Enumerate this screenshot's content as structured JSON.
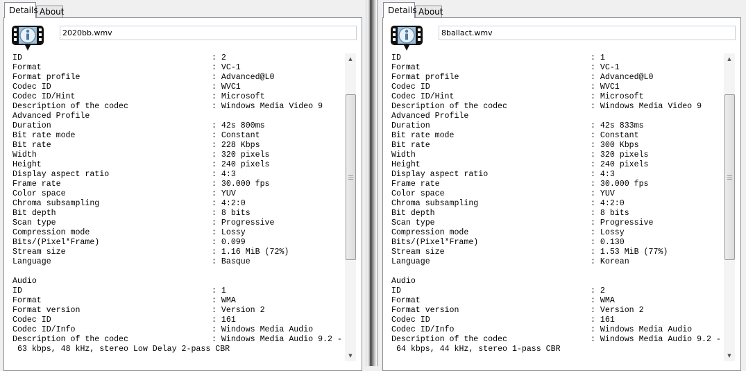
{
  "panels": [
    {
      "tabs": [
        "Details",
        "About"
      ],
      "filename": "2020bb.wmv",
      "scroll_fraction": 0.25,
      "lines": [
        [
          "ID",
          "2"
        ],
        [
          "Format",
          "VC-1"
        ],
        [
          "Format profile",
          "Advanced@L0"
        ],
        [
          "Codec ID",
          "WVC1"
        ],
        [
          "Codec ID/Hint",
          "Microsoft"
        ],
        [
          "Description of the codec",
          "Windows Media Video 9"
        ],
        [
          "Advanced Profile",
          null
        ],
        [
          "Duration",
          "42s 800ms"
        ],
        [
          "Bit rate mode",
          "Constant"
        ],
        [
          "Bit rate",
          "228 Kbps"
        ],
        [
          "Width",
          "320 pixels"
        ],
        [
          "Height",
          "240 pixels"
        ],
        [
          "Display aspect ratio",
          "4:3"
        ],
        [
          "Frame rate",
          "30.000 fps"
        ],
        [
          "Color space",
          "YUV"
        ],
        [
          "Chroma subsampling",
          "4:2:0"
        ],
        [
          "Bit depth",
          "8 bits"
        ],
        [
          "Scan type",
          "Progressive"
        ],
        [
          "Compression mode",
          "Lossy"
        ],
        [
          "Bits/(Pixel*Frame)",
          "0.099"
        ],
        [
          "Stream size",
          "1.16 MiB (72%)"
        ],
        [
          "Language",
          "Basque"
        ],
        [
          "",
          null
        ],
        [
          "Audio",
          null
        ],
        [
          "ID",
          "1"
        ],
        [
          "Format",
          "WMA"
        ],
        [
          "Format version",
          "Version 2"
        ],
        [
          "Codec ID",
          "161"
        ],
        [
          "Codec ID/Info",
          "Windows Media Audio"
        ],
        [
          "Description of the codec",
          "Windows Media Audio 9.2 -"
        ],
        [
          "~",
          "63 kbps, 48 kHz, stereo Low Delay 2-pass CBR"
        ]
      ]
    },
    {
      "tabs": [
        "Details",
        "About"
      ],
      "filename": "8ballact.wmv",
      "scroll_fraction": 0.25,
      "lines": [
        [
          "ID",
          "1"
        ],
        [
          "Format",
          "VC-1"
        ],
        [
          "Format profile",
          "Advanced@L0"
        ],
        [
          "Codec ID",
          "WVC1"
        ],
        [
          "Codec ID/Hint",
          "Microsoft"
        ],
        [
          "Description of the codec",
          "Windows Media Video 9"
        ],
        [
          "Advanced Profile",
          null
        ],
        [
          "Duration",
          "42s 833ms"
        ],
        [
          "Bit rate mode",
          "Constant"
        ],
        [
          "Bit rate",
          "300 Kbps"
        ],
        [
          "Width",
          "320 pixels"
        ],
        [
          "Height",
          "240 pixels"
        ],
        [
          "Display aspect ratio",
          "4:3"
        ],
        [
          "Frame rate",
          "30.000 fps"
        ],
        [
          "Color space",
          "YUV"
        ],
        [
          "Chroma subsampling",
          "4:2:0"
        ],
        [
          "Bit depth",
          "8 bits"
        ],
        [
          "Scan type",
          "Progressive"
        ],
        [
          "Compression mode",
          "Lossy"
        ],
        [
          "Bits/(Pixel*Frame)",
          "0.130"
        ],
        [
          "Stream size",
          "1.53 MiB (77%)"
        ],
        [
          "Language",
          "Korean"
        ],
        [
          "",
          null
        ],
        [
          "Audio",
          null
        ],
        [
          "ID",
          "2"
        ],
        [
          "Format",
          "WMA"
        ],
        [
          "Format version",
          "Version 2"
        ],
        [
          "Codec ID",
          "161"
        ],
        [
          "Codec ID/Info",
          "Windows Media Audio"
        ],
        [
          "Description of the codec",
          "Windows Media Audio 9.2 -"
        ],
        [
          "~",
          "64 kbps, 44 kHz, stereo 1-pass CBR"
        ]
      ]
    }
  ],
  "icons": {
    "info": "media-info-icon",
    "scroll_up": "scroll-up-arrow-icon",
    "scroll_down": "scroll-down-arrow-icon"
  },
  "colors": {
    "border": "#898c95",
    "background": "#f0f0f0",
    "icon_blue": "#9fc0dc"
  }
}
